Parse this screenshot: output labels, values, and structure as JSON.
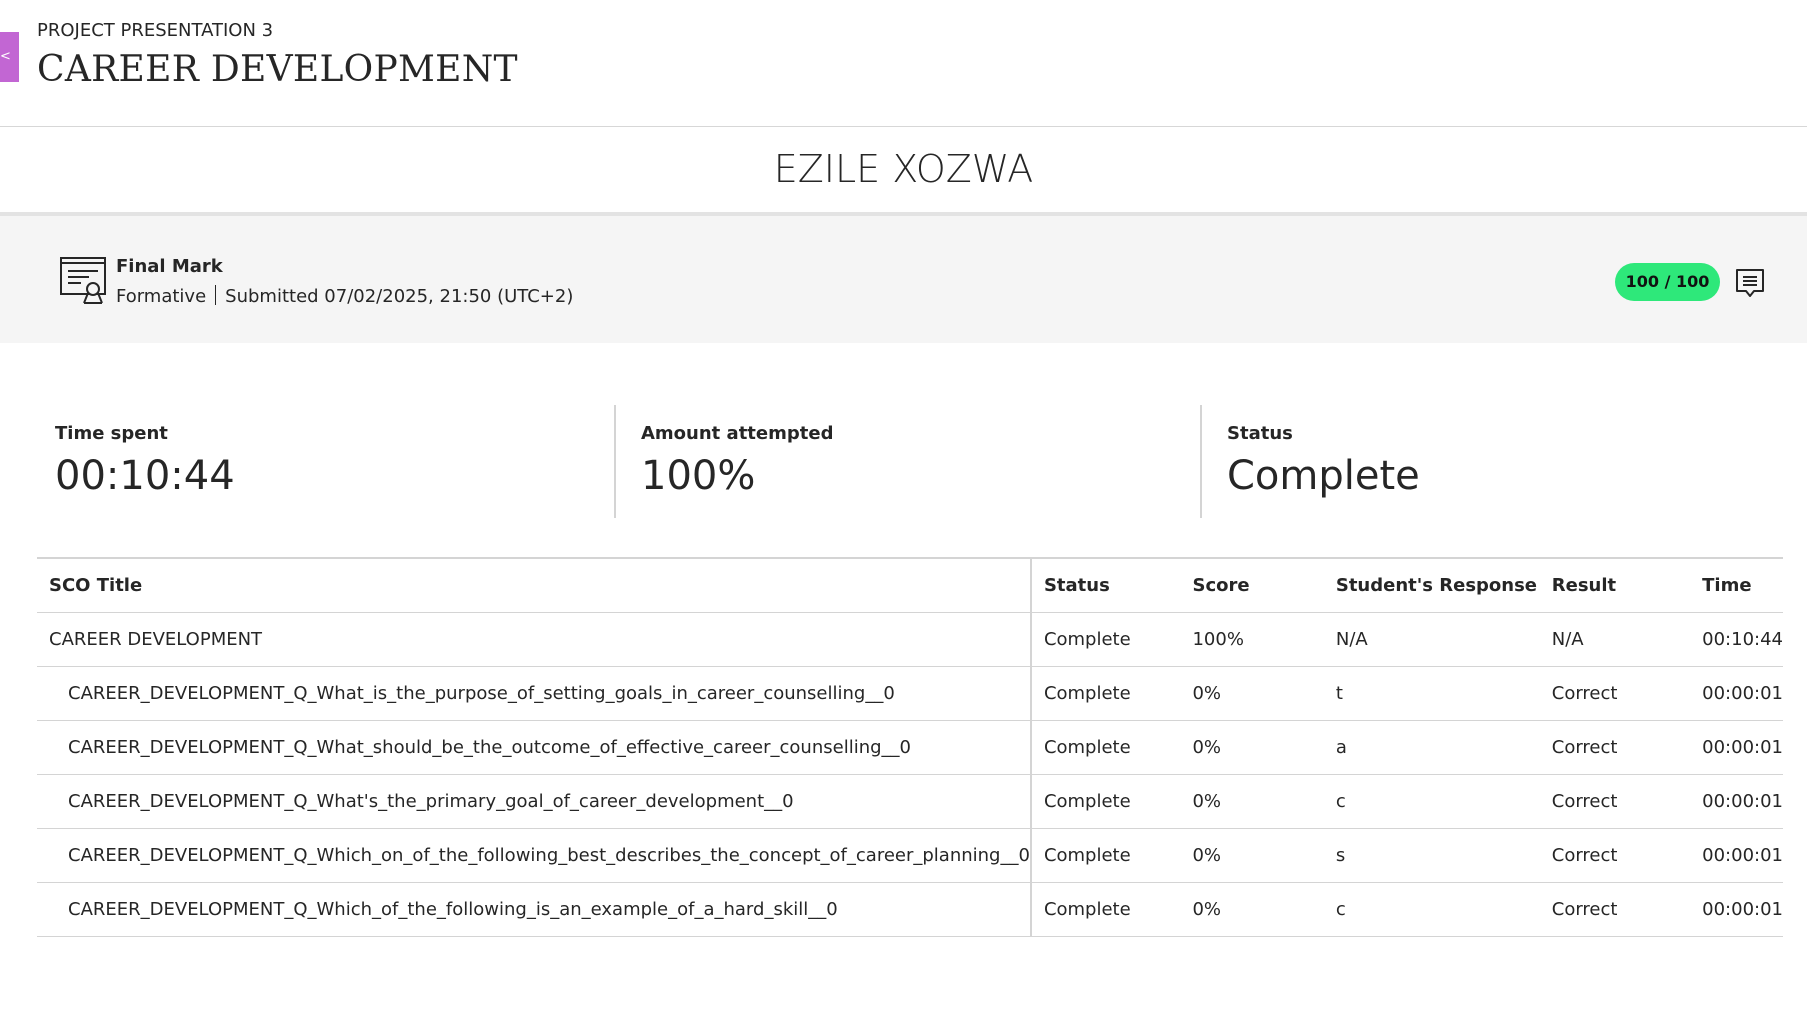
{
  "header": {
    "subtitle": "PROJECT PRESENTATION 3",
    "title": "CAREER DEVELOPMENT",
    "back_tab_glyph": "<"
  },
  "student": {
    "name": "EZILE XOZWA"
  },
  "final_mark": {
    "label": "Final Mark",
    "type": "Formative",
    "submitted": "Submitted 07/02/2025, 21:50 (UTC+2)",
    "score": "100 / 100",
    "score_color": "#2ee87a",
    "icon": "certificate-icon",
    "feedback_icon": "comment-icon"
  },
  "stats": [
    {
      "label": "Time spent",
      "value": "00:10:44"
    },
    {
      "label": "Amount attempted",
      "value": "100%"
    },
    {
      "label": "Status",
      "value": "Complete"
    }
  ],
  "table": {
    "headers": [
      "SCO Title",
      "Status",
      "Score",
      "Student's Response",
      "Result",
      "Time"
    ],
    "rows": [
      [
        "CAREER DEVELOPMENT",
        "Complete",
        "100%",
        "N/A",
        "N/A",
        "00:10:44"
      ],
      [
        "CAREER_DEVELOPMENT_Q_What_is_the_purpose_of_setting_goals_in_career_counselling__0",
        "Complete",
        "0%",
        "t",
        "Correct",
        "00:00:01"
      ],
      [
        "CAREER_DEVELOPMENT_Q_What_should_be_the_outcome_of_effective_career_counselling__0",
        "Complete",
        "0%",
        "a",
        "Correct",
        "00:00:01"
      ],
      [
        "CAREER_DEVELOPMENT_Q_What's_the_primary_goal_of_career_development__0",
        "Complete",
        "0%",
        "c",
        "Correct",
        "00:00:01"
      ],
      [
        "CAREER_DEVELOPMENT_Q_Which_on_of_the_following_best_describes_the_concept_of_career_planning__0",
        "Complete",
        "0%",
        "s",
        "Correct",
        "00:00:01"
      ],
      [
        "CAREER_DEVELOPMENT_Q_Which_of_the_following_is_an_example_of_a_hard_skill__0",
        "Complete",
        "0%",
        "c",
        "Correct",
        "00:00:01"
      ]
    ]
  }
}
